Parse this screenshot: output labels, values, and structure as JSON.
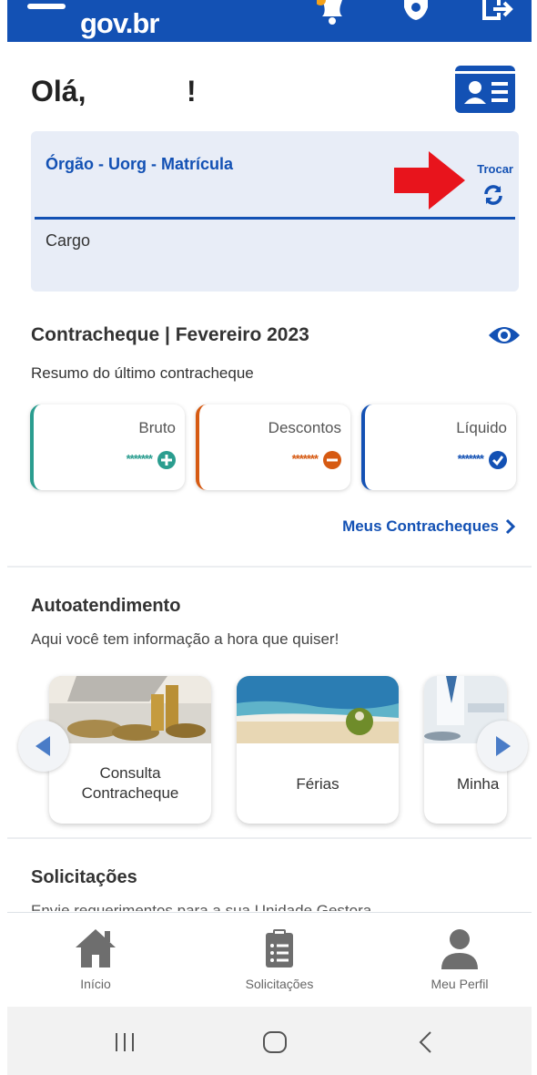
{
  "topbar": {
    "logo": "gov.br",
    "icons": [
      "menu-icon",
      "bell-icon",
      "gear-icon",
      "exit-icon"
    ],
    "color": "#1351b4"
  },
  "greeting": {
    "hello": "Olá,",
    "excl": "!"
  },
  "vinculo": {
    "orgao_label": "Órgão - Uorg - Matrícula",
    "trocar_label": "Trocar",
    "cargo_label": "Cargo"
  },
  "contracheque": {
    "title": "Contracheque | Fevereiro 2023",
    "subtitle": "Resumo do último contracheque",
    "cards": [
      {
        "label": "Bruto",
        "value": "*******",
        "icon": "plus-circle-icon",
        "color": "#2a9d8f"
      },
      {
        "label": "Descontos",
        "value": "*******",
        "icon": "minus-circle-icon",
        "color": "#d65a12"
      },
      {
        "label": "Líquido",
        "value": "*******",
        "icon": "check-circle-icon",
        "color": "#1351b4"
      }
    ],
    "link": "Meus Contracheques"
  },
  "autoatendimento": {
    "title": "Autoatendimento",
    "subtitle": "Aqui você tem informação a hora que quiser!",
    "tiles": [
      {
        "label_line1": "Consulta",
        "label_line2": "Contracheque"
      },
      {
        "label_line1": "Férias"
      },
      {
        "label_line1": "Minha"
      }
    ]
  },
  "solicitacoes": {
    "title": "Solicitações",
    "subtitle": "Envie requerimentos para a sua Unidade Gestora"
  },
  "bottomnav": {
    "items": [
      {
        "label": "Início",
        "icon": "home-icon"
      },
      {
        "label": "Solicitações",
        "icon": "clipboard-list-icon"
      },
      {
        "label": "Meu Perfil",
        "icon": "user-icon"
      }
    ]
  },
  "system_nav": [
    "recent-apps-icon",
    "home-circle-icon",
    "back-icon"
  ]
}
